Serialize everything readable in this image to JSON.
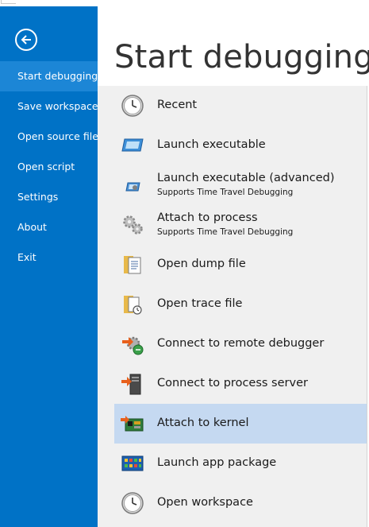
{
  "title": "Start debugging",
  "back": {
    "icon": "back-arrow-icon"
  },
  "sidebar": {
    "items": [
      {
        "label": "Start debugging"
      },
      {
        "label": "Save workspace"
      },
      {
        "label": "Open source file"
      },
      {
        "label": "Open script"
      },
      {
        "label": "Settings"
      },
      {
        "label": "About"
      },
      {
        "label": "Exit"
      }
    ],
    "active_index": 0
  },
  "commands": [
    {
      "label": "Recent",
      "icon": "clock-icon"
    },
    {
      "label": "Launch executable",
      "icon": "window-icon"
    },
    {
      "label": "Launch executable (advanced)",
      "sub": "Supports Time Travel Debugging",
      "icon": "advanced-launch-icon"
    },
    {
      "label": "Attach to process",
      "sub": "Supports Time Travel Debugging",
      "icon": "gears-icon"
    },
    {
      "label": "Open dump file",
      "icon": "dump-file-icon"
    },
    {
      "label": "Open trace file",
      "icon": "trace-file-icon"
    },
    {
      "label": "Connect to remote debugger",
      "icon": "remote-debugger-icon"
    },
    {
      "label": "Connect to process server",
      "icon": "process-server-icon"
    },
    {
      "label": "Attach to kernel",
      "icon": "kernel-board-icon"
    },
    {
      "label": "Launch app package",
      "icon": "app-package-icon"
    },
    {
      "label": "Open workspace",
      "icon": "workspace-clock-icon"
    }
  ],
  "highlighted_index": 8,
  "colors": {
    "sidebar": "#0072c6",
    "sidebar_active": "#1c86d6",
    "panel": "#f0f0f0",
    "highlight": "#c5d9f1"
  }
}
